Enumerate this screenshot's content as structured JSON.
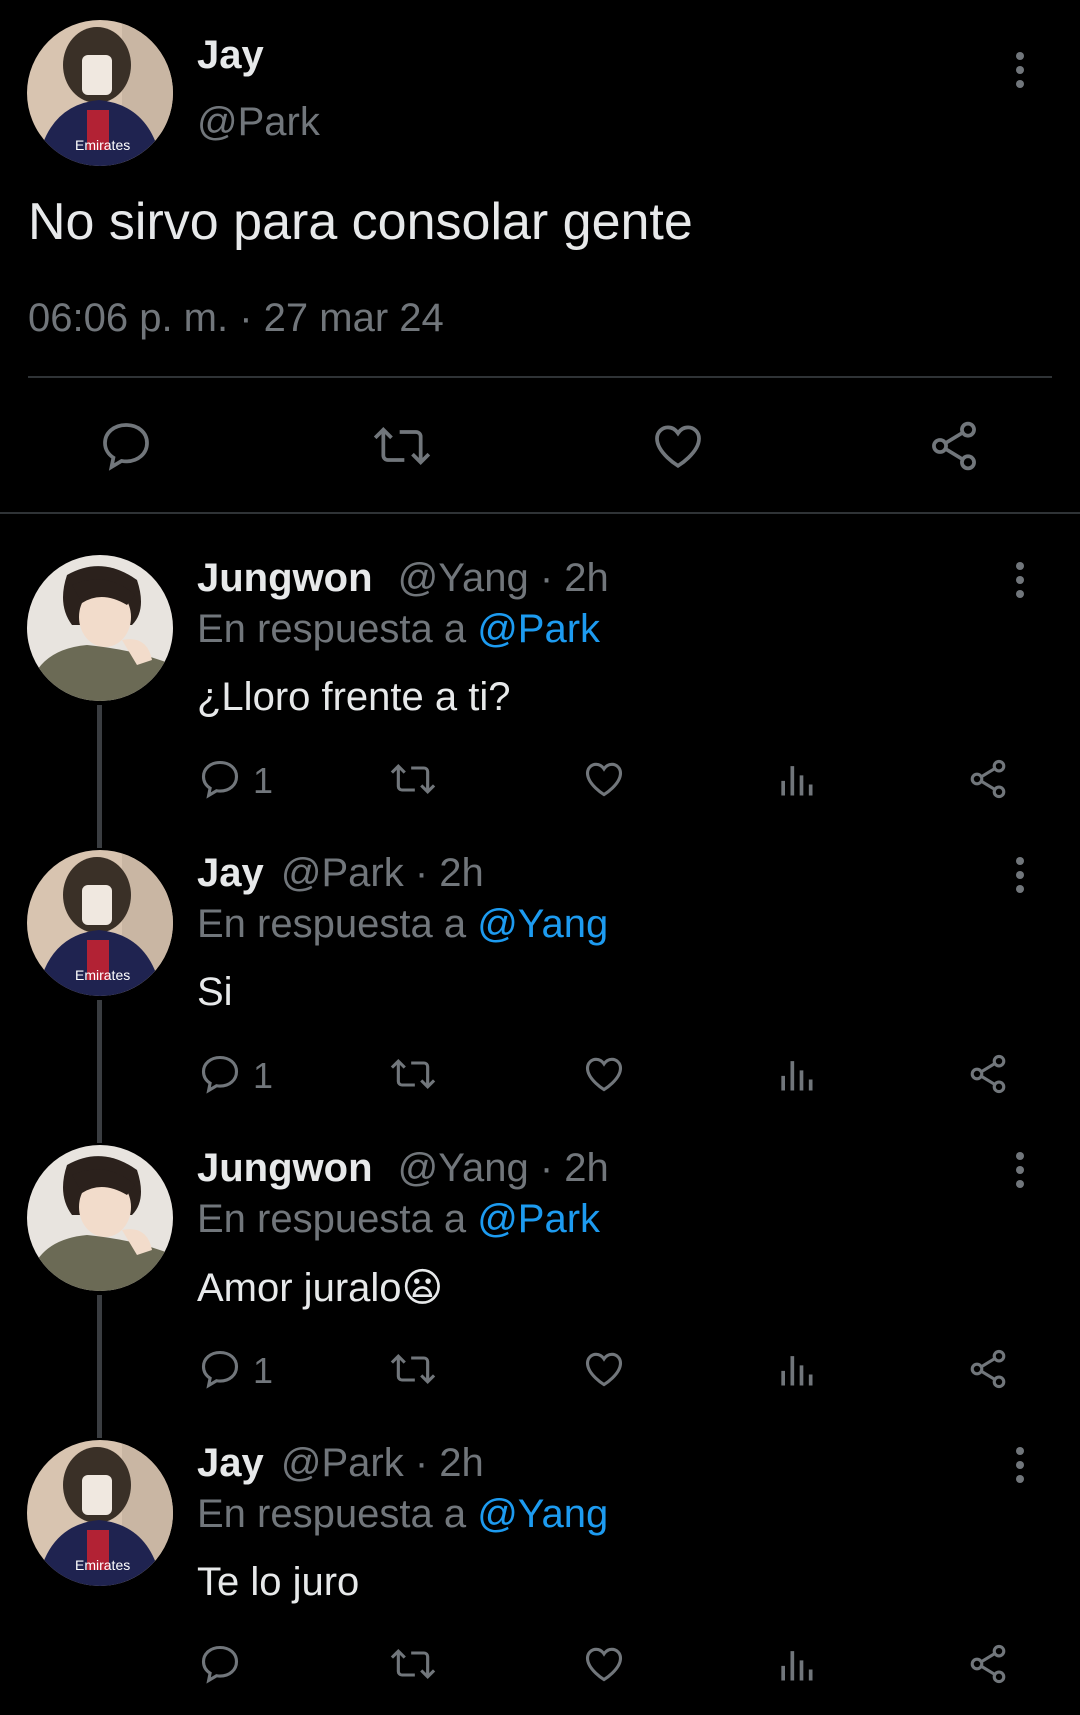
{
  "main_tweet": {
    "name": "Jay",
    "handle": "@Park",
    "text": "No sirvo para consolar gente",
    "timestamp": "06:06 p. m. · 27 mar 24"
  },
  "replies": [
    {
      "name": "Jungwon",
      "handle": "@Yang",
      "time": "· 2h",
      "reply_prefix": "En respuesta a",
      "reply_to": "@Park",
      "text": "¿Lloro frente a ti?",
      "reply_count": "1"
    },
    {
      "name": "Jay",
      "handle": "@Park",
      "time": "· 2h",
      "reply_prefix": "En respuesta a",
      "reply_to": "@Yang",
      "text": "Si",
      "reply_count": "1"
    },
    {
      "name": "Jungwon",
      "handle": "@Yang",
      "time": "· 2h",
      "reply_prefix": "En respuesta a",
      "reply_to": "@Park",
      "text": "Amor juralo",
      "emoji": "😦",
      "reply_count": "1"
    },
    {
      "name": "Jay",
      "handle": "@Park",
      "time": "· 2h",
      "reply_prefix": "En respuesta a",
      "reply_to": "@Yang",
      "text": "Te lo juro",
      "reply_count": ""
    }
  ],
  "icons": {
    "reply": "speech-bubble-icon",
    "retweet": "retweet-icon",
    "like": "heart-icon",
    "views": "bar-chart-icon",
    "share": "share-icon",
    "more": "vertical-dots-icon"
  },
  "colors": {
    "background": "#000000",
    "text": "#e7e9ea",
    "secondary": "#71767b",
    "accent": "#1d9bf0"
  }
}
